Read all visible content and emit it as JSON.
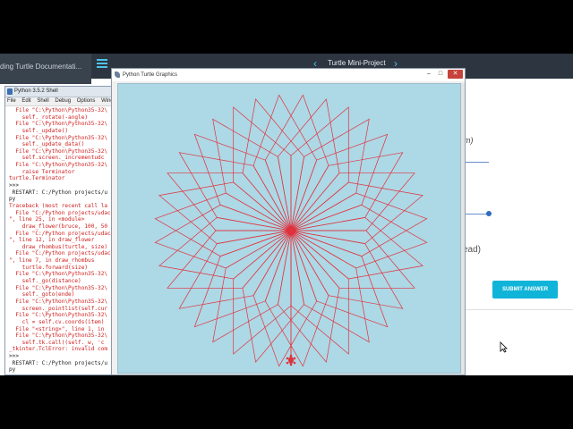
{
  "browser": {
    "tab_title": "ding Turtle Documentati...",
    "lesson_title": "Turtle Mini-Project",
    "prev_symbol": "‹",
    "next_symbol": "›",
    "fragment_m": "m)",
    "fragment_ead": "ead)",
    "submit_label": "SUBMIT ANSWER",
    "accent_color": "#10b4d8"
  },
  "shell": {
    "title": "Python 3.5.2 Shell",
    "menu": [
      "File",
      "Edit",
      "Shell",
      "Debug",
      "Options",
      "Wind"
    ],
    "lines": [
      {
        "t": "  File \"C:\\Python\\Python35-32\\",
        "k": "err"
      },
      {
        "t": "    self._rotate(-angle)",
        "k": "err"
      },
      {
        "t": "  File \"C:\\Python\\Python35-32\\",
        "k": "err"
      },
      {
        "t": "    self._update()",
        "k": "err"
      },
      {
        "t": "  File \"C:\\Python\\Python35-32\\",
        "k": "err"
      },
      {
        "t": "    self._update_data()",
        "k": "err"
      },
      {
        "t": "  File \"C:\\Python\\Python35-32\\",
        "k": "err"
      },
      {
        "t": "    self.screen._incrementudc",
        "k": "err"
      },
      {
        "t": "  File \"C:\\Python\\Python35-32\\",
        "k": "err"
      },
      {
        "t": "    raise Terminator",
        "k": "err"
      },
      {
        "t": "turtle.Terminator",
        "k": "err"
      },
      {
        "t": ">>> ",
        "k": "out"
      },
      {
        "t": " RESTART: C:/Python projects/u",
        "k": "out"
      },
      {
        "t": "py",
        "k": "out"
      },
      {
        "t": "Traceback (most recent call la",
        "k": "err"
      },
      {
        "t": "  File \"C:/Python projects/udac",
        "k": "err"
      },
      {
        "t": "\", line 25, in <module>",
        "k": "err"
      },
      {
        "t": "    draw_flower(bruce, 100, 50",
        "k": "err"
      },
      {
        "t": "  File \"C:/Python projects/udac",
        "k": "err"
      },
      {
        "t": "\", line 12, in draw_flower",
        "k": "err"
      },
      {
        "t": "    draw_rhombus(turtle, size)",
        "k": "err"
      },
      {
        "t": "  File \"C:/Python projects/udac",
        "k": "err"
      },
      {
        "t": "\", line 7, in draw_rhombus",
        "k": "err"
      },
      {
        "t": "    turtle.forward(size)",
        "k": "err"
      },
      {
        "t": "  File \"C:\\Python\\Python35-32\\",
        "k": "err"
      },
      {
        "t": "    self._go(distance)",
        "k": "err"
      },
      {
        "t": "  File \"C:\\Python\\Python35-32\\",
        "k": "err"
      },
      {
        "t": "    self._goto(ende)",
        "k": "err"
      },
      {
        "t": "  File \"C:\\Python\\Python35-32\\",
        "k": "err"
      },
      {
        "t": "    screen._pointlist(self.cur",
        "k": "err"
      },
      {
        "t": "  File \"C:\\Python\\Python35-32\\",
        "k": "err"
      },
      {
        "t": "    cl = self.cv.coords(item)",
        "k": "err"
      },
      {
        "t": "  File \"<string>\", line 1, in",
        "k": "err"
      },
      {
        "t": "  File \"C:\\Python\\Python35-32\\",
        "k": "err"
      },
      {
        "t": "    self.tk.call((self._w, 'c",
        "k": "err"
      },
      {
        "t": "_tkinter.TclError: invalid com",
        "k": "err"
      },
      {
        "t": ">>> ",
        "k": "out"
      },
      {
        "t": " RESTART: C:/Python projects/u",
        "k": "out"
      },
      {
        "t": "py",
        "k": "out"
      }
    ]
  },
  "turtle_window": {
    "title": "Python Turtle Graphics",
    "min_symbol": "–",
    "max_symbol": "□",
    "close_symbol": "✕",
    "line_color": "#e0323c",
    "background_color": "#add8e6",
    "rhombus_count": 36,
    "rhombus_angle_deg": 50
  }
}
